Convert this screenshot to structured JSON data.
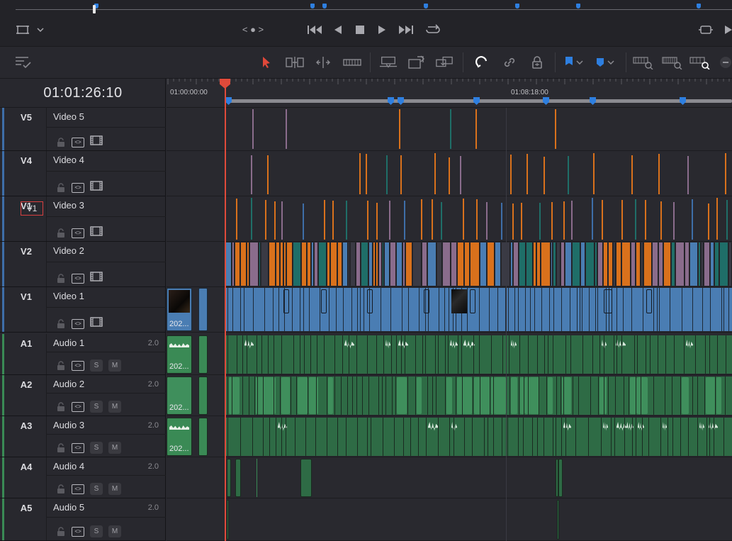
{
  "timecode": "01:01:26:10",
  "ruler": {
    "start_label": "01:00:00:00",
    "mid_label": "01:08:18:00"
  },
  "tracks": [
    {
      "id": "V5",
      "name": "Video 5",
      "kind": "video"
    },
    {
      "id": "V4",
      "name": "Video 4",
      "kind": "video"
    },
    {
      "id": "V1",
      "name": "Video 3",
      "kind": "video",
      "dest_badge": "V1"
    },
    {
      "id": "V2",
      "name": "Video 2",
      "kind": "video"
    },
    {
      "id": "V1",
      "name": "Video 1",
      "kind": "video"
    },
    {
      "id": "A1",
      "name": "Audio 1",
      "kind": "audio",
      "channels": "2.0"
    },
    {
      "id": "A2",
      "name": "Audio 2",
      "kind": "audio",
      "channels": "2.0"
    },
    {
      "id": "A3",
      "name": "Audio 3",
      "kind": "audio",
      "channels": "2.0"
    },
    {
      "id": "A4",
      "name": "Audio 4",
      "kind": "audio",
      "channels": "2.0"
    },
    {
      "id": "A5",
      "name": "Audio 5",
      "kind": "audio",
      "channels": "2.0"
    }
  ],
  "buttons": {
    "solo": "S",
    "mute": "M"
  },
  "clip_names": {
    "v1_first": "202...",
    "a1_first": "202...",
    "a2_first": "202...",
    "a3_first": "202..."
  },
  "transport": {
    "prev_next": "< ● >"
  },
  "colors": {
    "video_clip": "#4a7db3",
    "audio_clip": "#2e6b45",
    "audio_clip_light": "#3f8f5c",
    "orange": "#d9711c",
    "teal": "#1f6e68",
    "purple": "#8a6c8c",
    "playhead": "#e04a3a",
    "marker": "#2e7fe0"
  }
}
